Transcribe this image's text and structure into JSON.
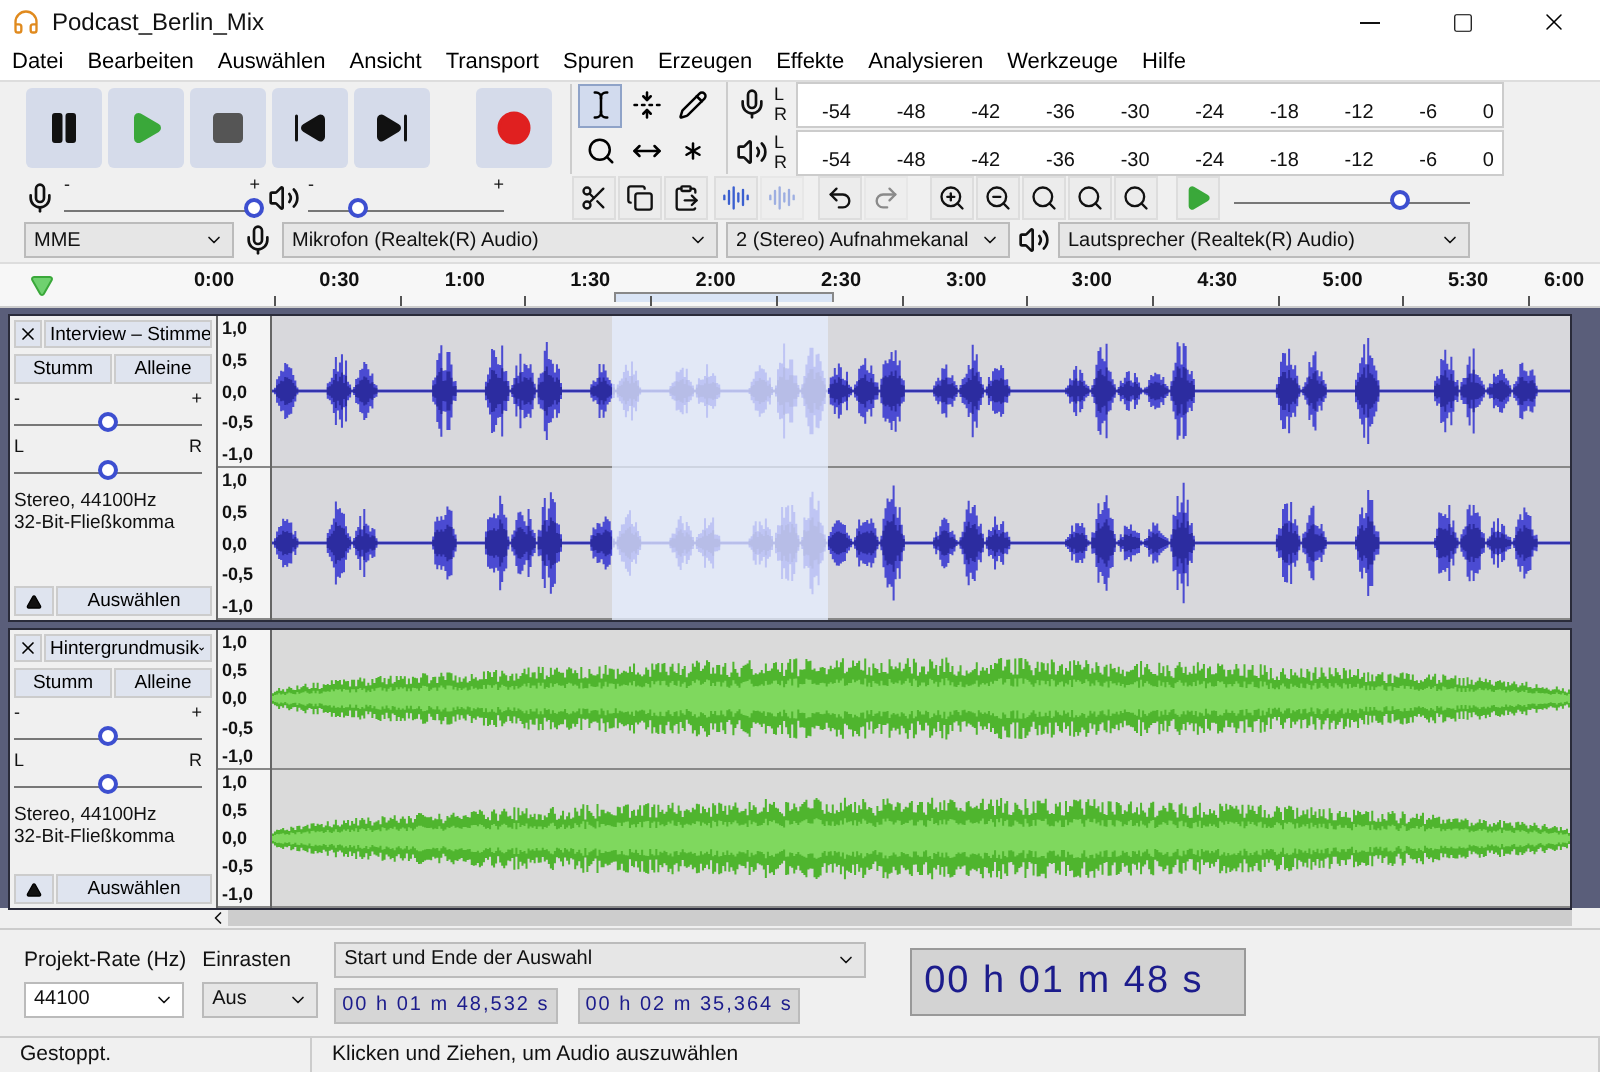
{
  "window": {
    "title": "Podcast_Berlin_Mix"
  },
  "menu": [
    "Datei",
    "Bearbeiten",
    "Auswählen",
    "Ansicht",
    "Transport",
    "Spuren",
    "Erzeugen",
    "Effekte",
    "Analysieren",
    "Werkzeuge",
    "Hilfe"
  ],
  "transport": [
    {
      "kind": "pause"
    },
    {
      "kind": "play"
    },
    {
      "kind": "stop"
    },
    {
      "kind": "skip_start"
    },
    {
      "kind": "skip_end"
    },
    {
      "kind": "record"
    }
  ],
  "tools": [
    {
      "kind": "select",
      "selected": true
    },
    {
      "kind": "envelope",
      "selected": false
    },
    {
      "kind": "draw",
      "selected": false
    },
    {
      "kind": "zoom",
      "selected": false
    },
    {
      "kind": "timeshift",
      "selected": false
    },
    {
      "kind": "multi",
      "selected": false
    }
  ],
  "meters": [
    {
      "kind": "record",
      "channels": [
        "L",
        "R"
      ],
      "ticks": [
        "-54",
        "-48",
        "-42",
        "-36",
        "-30",
        "-24",
        "-18",
        "-12",
        "-6",
        "0"
      ]
    },
    {
      "kind": "playback",
      "channels": [
        "L",
        "R"
      ],
      "ticks": [
        "-54",
        "-48",
        "-42",
        "-36",
        "-30",
        "-24",
        "-18",
        "-12",
        "-6",
        "0"
      ]
    }
  ],
  "mixer": [
    {
      "kind": "record",
      "min": "-",
      "max": "+",
      "level": 0.97
    },
    {
      "kind": "playback",
      "min": "-",
      "max": "+",
      "level": 0.25
    }
  ],
  "edit_tools": [
    {
      "kind": "cut",
      "disabled": false
    },
    {
      "kind": "copy",
      "disabled": false
    },
    {
      "kind": "paste",
      "disabled": false
    },
    {
      "kind": "trim",
      "disabled": false
    },
    {
      "kind": "silence",
      "disabled": true
    },
    {
      "kind": "undo",
      "disabled": false
    },
    {
      "kind": "redo",
      "disabled": true
    },
    {
      "kind": "zoom_in",
      "disabled": false
    },
    {
      "kind": "zoom_out",
      "disabled": false
    },
    {
      "kind": "fit_selection",
      "disabled": false
    },
    {
      "kind": "fit_project",
      "disabled": false
    },
    {
      "kind": "zoom_toggle",
      "disabled": false
    }
  ],
  "play_at_speed": {
    "level": 0.7
  },
  "devices": [
    {
      "kind": "host",
      "value": "MME"
    },
    {
      "kind": "input",
      "value": "Mikrofon (Realtek(R) Audio)"
    },
    {
      "kind": "channels",
      "value": "2 (Stereo) Aufnahmekanal"
    },
    {
      "kind": "output",
      "value": "Lautsprecher (Realtek(R) Audio)"
    }
  ],
  "timeline": {
    "ticks": [
      "0:00",
      "0:30",
      "1:00",
      "1:30",
      "2:00",
      "2:30",
      "3:00",
      "3:00",
      "4:30",
      "5:00",
      "5:30",
      "6:00"
    ]
  },
  "tracks": [
    {
      "kind": "speech",
      "name": "Interview – Stimme",
      "color": "#4b4bd2",
      "selected": true,
      "mute": "Stumm",
      "solo": "Alleine",
      "gain": {
        "min": "-",
        "max": "+",
        "level": 0.5
      },
      "pan": {
        "min": "L",
        "max": "R",
        "level": 0.5
      },
      "info": [
        "Stereo, 44100Hz",
        "32-Bit-Fließkomma"
      ],
      "select_button": "Auswählen",
      "channels": [
        {
          "scale": [
            "1,0",
            "0,5",
            "0,0",
            "-0,5",
            "-1,0"
          ]
        },
        {
          "scale": [
            "1,0",
            "0,5",
            "0,0",
            "-0,5",
            "-1,0"
          ]
        }
      ]
    },
    {
      "kind": "music",
      "name": "Hintergrundmusik",
      "color": "#4fb52e",
      "selected": false,
      "mute": "Stumm",
      "solo": "Alleine",
      "gain": {
        "min": "-",
        "max": "+",
        "level": 0.5
      },
      "pan": {
        "min": "L",
        "max": "R",
        "level": 0.5
      },
      "info": [
        "Stereo, 44100Hz",
        "32-Bit-Fließkomma"
      ],
      "select_button": "Auswählen",
      "channels": [
        {
          "scale": [
            "1,0",
            "0,5",
            "0,0",
            "-0,5",
            "-1,0"
          ]
        },
        {
          "scale": [
            "1,0",
            "0,5",
            "0,0",
            "-0,5",
            "-1,0"
          ]
        }
      ]
    }
  ],
  "selection_toolbar": {
    "rate_label": "Projekt-Rate (Hz)",
    "rate": "44100",
    "snap_label": "Einrasten",
    "snap": "Aus",
    "mode": "Start und Ende der Auswahl",
    "start": "00 h 01 m 48,532 s",
    "end": "00 h 02 m 35,364 s"
  },
  "time_display": "00 h 01 m 48 s",
  "status_bar": {
    "state": "Gestoppt.",
    "hint": "Klicken und Ziehen, um Audio auszuwählen"
  }
}
